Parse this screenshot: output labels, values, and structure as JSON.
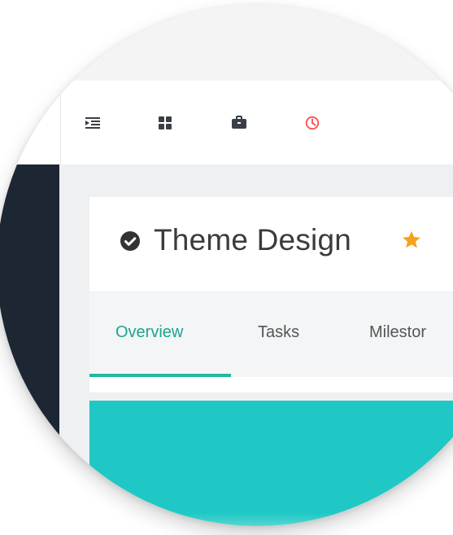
{
  "project": {
    "title": "Theme Design",
    "status_icon": "check-circle-icon",
    "favorite_icon": "star-icon"
  },
  "toolbar": {
    "icons": [
      "indent-menu-icon",
      "grid-icon",
      "briefcase-icon",
      "clock-icon"
    ]
  },
  "tabs": [
    {
      "label": "Overview",
      "active": true
    },
    {
      "label": "Tasks",
      "active": false
    },
    {
      "label": "Milestor",
      "active": false
    }
  ],
  "colors": {
    "sidebar": "#1d2633",
    "accent": "#1aa58e",
    "accent_bar": "#23b89f",
    "teal_panel": "#1fc8c4",
    "clock": "#ff4a4a",
    "star": "#f7a21b",
    "dot": "#3d8df0"
  }
}
